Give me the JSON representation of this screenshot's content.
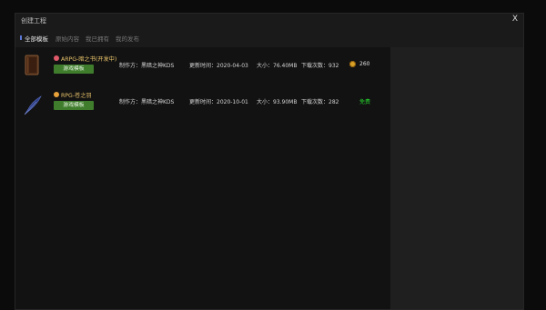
{
  "dialog": {
    "title": "创建工程",
    "close": "X"
  },
  "tabs": [
    {
      "label": "全部模板"
    },
    {
      "label": "原始内容"
    },
    {
      "label": "我已拥有"
    },
    {
      "label": "我的发布"
    }
  ],
  "items": [
    {
      "name": "ARPG-暗之书(开发中)",
      "button": "游戏模板",
      "maker": "制作方：黑暗之神KDS",
      "updated": "更新时间：2020-04-03",
      "size": "大小：76.40MB",
      "downloads": "下载次数：932",
      "price": "260",
      "colors": {
        "dot": "#e05a6a"
      }
    },
    {
      "name": "RPG-苍之羽",
      "button": "游戏模板",
      "maker": "制作方：黑暗之神KDS",
      "updated": "更新时间：2020-10-01",
      "size": "大小：93.90MB",
      "downloads": "下载次数：282",
      "price": "免费",
      "colors": {
        "dot": "#e7a23a"
      }
    }
  ],
  "colors": {
    "accent": "#3f7d2d",
    "free": "#26d12d",
    "active_tab_marker": "#5b78d6"
  },
  "icons": {
    "item1": "book-icon",
    "item2": "feather-quill-icon",
    "price1": "coin-icon"
  }
}
